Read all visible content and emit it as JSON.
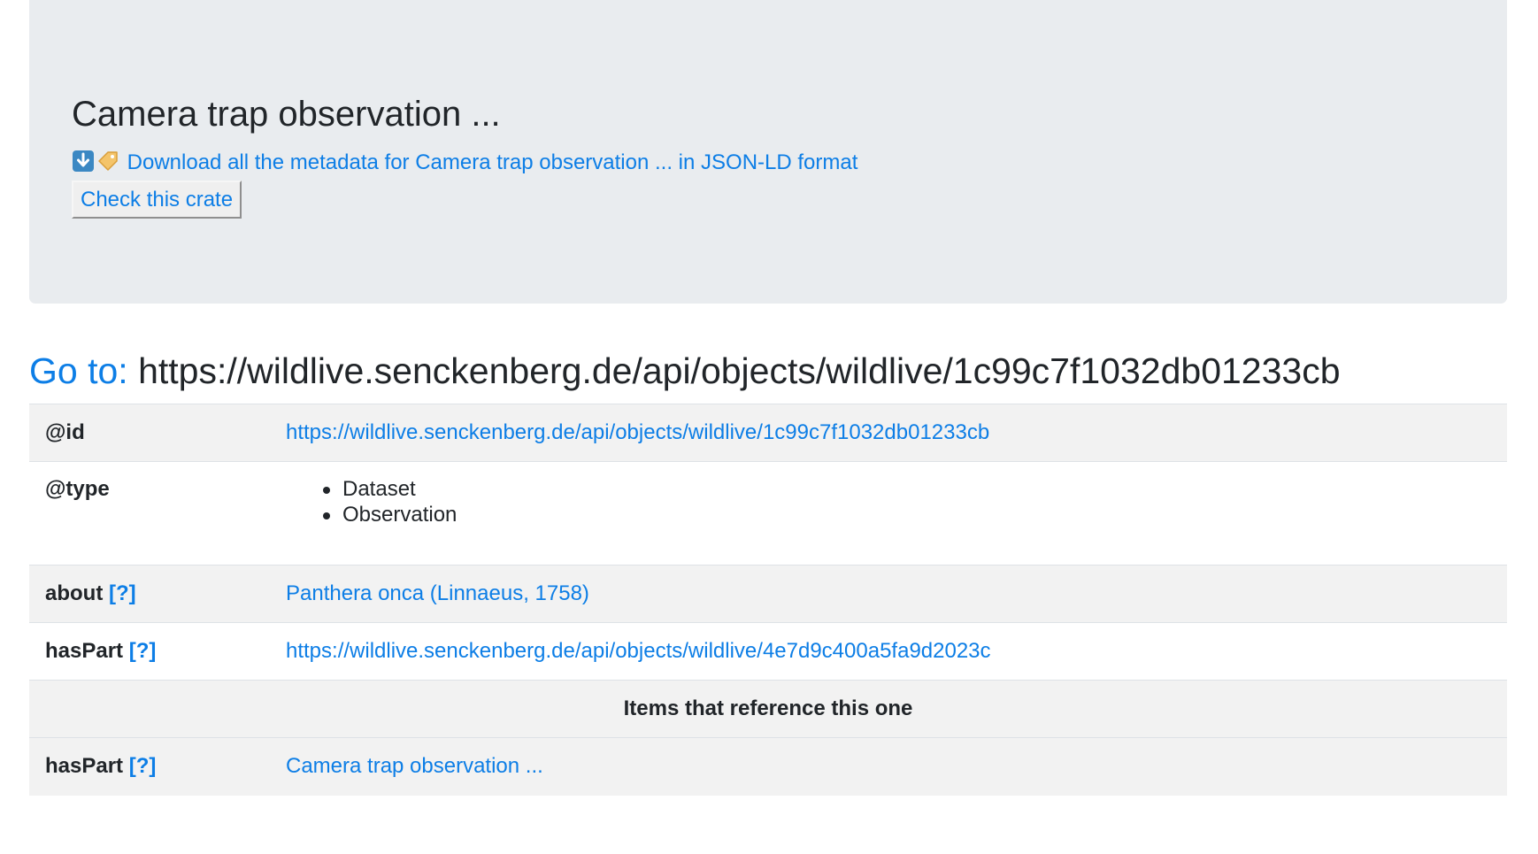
{
  "header": {
    "title": "Camera trap observation ...",
    "download_text": "Download all the metadata for Camera trap observation ... in JSON-LD format",
    "check_button": "Check this crate"
  },
  "goto": {
    "label": "Go to:",
    "url": "https://wildlive.senckenberg.de/api/objects/wildlive/1c99c7f1032db01233cb"
  },
  "properties": {
    "id": {
      "key": "@id",
      "value": "https://wildlive.senckenberg.de/api/objects/wildlive/1c99c7f1032db01233cb"
    },
    "type": {
      "key": "@type",
      "values": [
        "Dataset",
        "Observation"
      ]
    },
    "about": {
      "key": "about",
      "help": "[?]",
      "value": "Panthera onca (Linnaeus, 1758)"
    },
    "hasPart": {
      "key": "hasPart",
      "help": "[?]",
      "value": "https://wildlive.senckenberg.de/api/objects/wildlive/4e7d9c400a5fa9d2023c"
    }
  },
  "reverse": {
    "heading": "Items that reference this one",
    "hasPart": {
      "key": "hasPart",
      "help": "[?]",
      "value": "Camera trap observation ..."
    }
  },
  "icons": {
    "download": "down-arrow-emoji",
    "label": "tag-emoji"
  },
  "colors": {
    "link": "#0d7ee6",
    "jumbotron": "#e9ecef",
    "row_shade": "#f2f2f2",
    "text": "#212529"
  }
}
